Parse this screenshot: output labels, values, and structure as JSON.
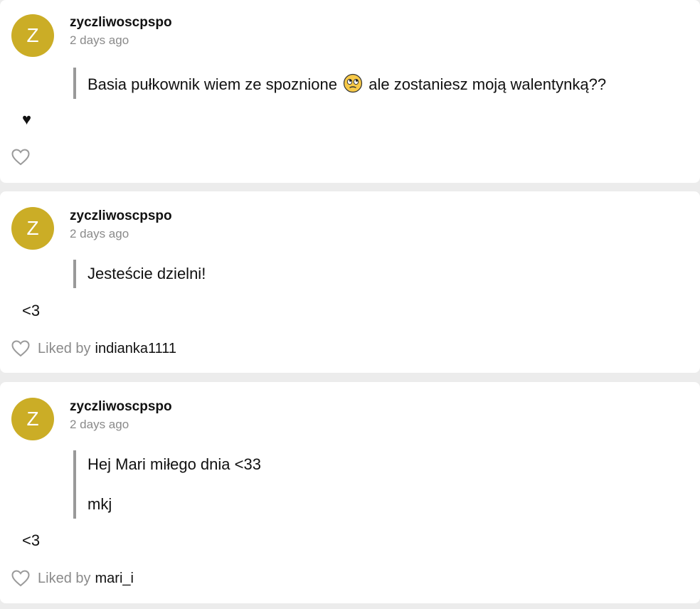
{
  "comments": [
    {
      "avatar_letter": "Z",
      "username": "zyczliwoscpspo",
      "time": "2 days ago",
      "quote_before_emoji": "Basia pułkownik wiem ze spoznione",
      "emoji": "rolling-eyes-emoji",
      "quote_after_emoji": "ale zostaniesz moją walentynką??",
      "trailing_text": "♥",
      "liked_by_label": "",
      "liked_by_user": ""
    },
    {
      "avatar_letter": "Z",
      "username": "zyczliwoscpspo",
      "time": "2 days ago",
      "quote_lines": [
        "Jesteście dzielni!"
      ],
      "trailing_text": "<3",
      "liked_by_label": "Liked by",
      "liked_by_user": "indianka1111"
    },
    {
      "avatar_letter": "Z",
      "username": "zyczliwoscpspo",
      "time": "2 days ago",
      "quote_lines": [
        "Hej Mari miłego dnia <33",
        "mkj"
      ],
      "trailing_text": "<3",
      "liked_by_label": "Liked by",
      "liked_by_user": "mari_i"
    }
  ],
  "icons": {
    "like": "heart-outline-icon"
  },
  "colors": {
    "avatar": "#cbad26",
    "page_background": "#ececec",
    "muted_text": "#8a8a8a",
    "quote_bar": "#999999"
  }
}
